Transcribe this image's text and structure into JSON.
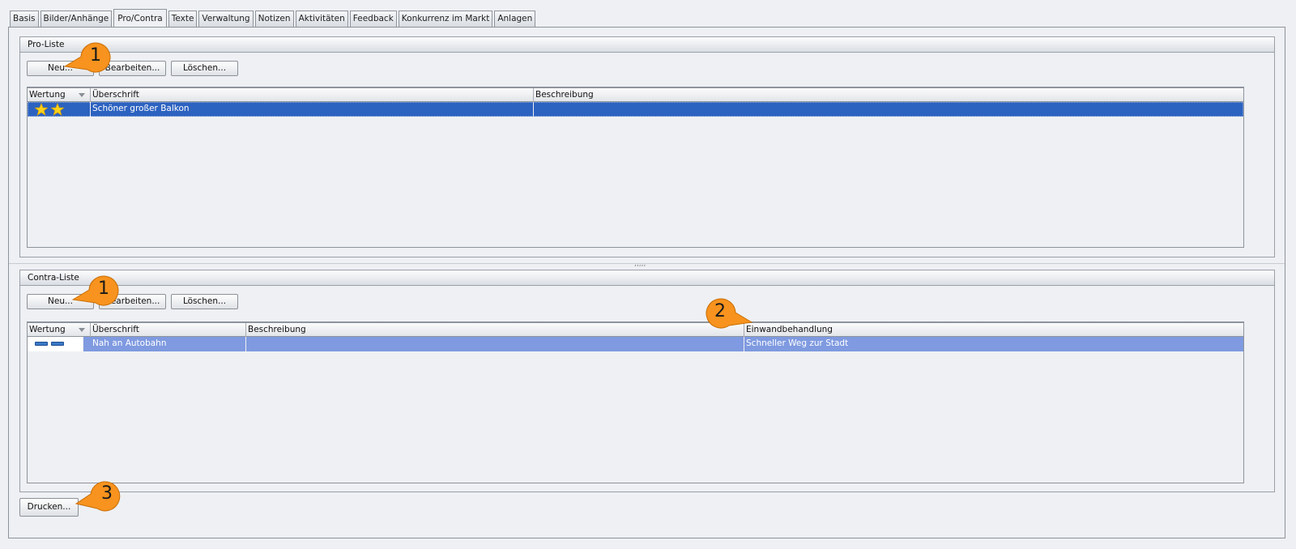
{
  "tabs": [
    "Basis",
    "Bilder/Anhänge",
    "Pro/Contra",
    "Texte",
    "Verwaltung",
    "Notizen",
    "Aktivitäten",
    "Feedback",
    "Konkurrenz im Markt",
    "Anlagen"
  ],
  "pro": {
    "title": "Pro-Liste",
    "buttons": {
      "new": "Neu...",
      "edit": "Bearbeiten...",
      "delete": "Löschen..."
    },
    "columns": [
      "Wertung",
      "Überschrift",
      "Beschreibung"
    ],
    "rows": [
      {
        "rating": 2,
        "heading": "Schöner großer Balkon",
        "description": ""
      }
    ]
  },
  "contra": {
    "title": "Contra-Liste",
    "buttons": {
      "new": "Neu...",
      "edit": "Bearbeiten...",
      "delete": "Löschen..."
    },
    "columns": [
      "Wertung",
      "Überschrift",
      "Beschreibung",
      "Einwandbehandlung"
    ],
    "rows": [
      {
        "rating": 2,
        "heading": "Nah an Autobahn",
        "description": "",
        "objection_handling": "Schneller Weg zur Stadt"
      }
    ]
  },
  "print_button": "Drucken...",
  "splitter_grip": ",,,,,",
  "callouts": [
    "1",
    "1",
    "2",
    "3"
  ],
  "colors": {
    "callout": "#f7931e",
    "selection": "#2c62c0",
    "selection_light": "#7f9ae0",
    "star": "#ffd21a"
  }
}
